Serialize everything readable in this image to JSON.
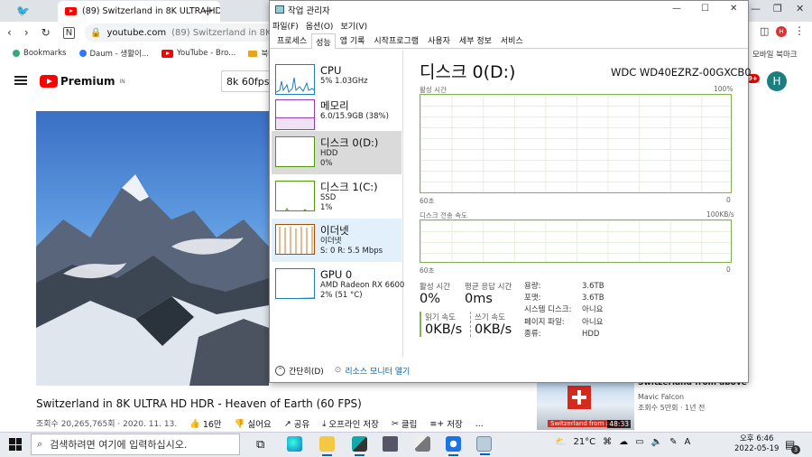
{
  "browser": {
    "tab_title": "(89) Switzerland in 8K ULTRA HD HDR",
    "url_domain": "youtube.com",
    "url_rest": "(89) Switzerland in 8K ULTRA HD",
    "avatar_letter": "H",
    "bookmarks": [
      "Bookmarks",
      "Daum - 생활이...",
      "YouTube - Bro...",
      "북마크"
    ],
    "bookmarks_right": "모바일 북마크"
  },
  "youtube": {
    "logo": "Premium",
    "region": "IN",
    "search_value": "8k 60fps",
    "notif_count": "9+",
    "avatar_letter": "H",
    "title": "Switzerland in 8K ULTRA HD HDR - Heaven of Earth (60 FPS)",
    "meta": "조회수 20,265,765회 · 2020. 11. 13.",
    "actions": {
      "like": "16만",
      "dislike": "싫어요",
      "share": "공유",
      "download": "오프라인 저장",
      "clip": "클립",
      "save": "저장",
      "more": "..."
    },
    "side": {
      "title": "Switzerland from above",
      "channel": "Mavic Falcon",
      "meta": "조회수 5만회 · 1년 전",
      "thumb_caption": "Switzerland from abov",
      "duration": "48:33"
    }
  },
  "taskmanager": {
    "title": "작업 관리자",
    "menu": [
      "파일(F)",
      "옵션(O)",
      "보기(V)"
    ],
    "tabs": [
      "프로세스",
      "성능",
      "앱 기록",
      "시작프로그램",
      "사용자",
      "세부 정보",
      "서비스"
    ],
    "active_tab": "성능",
    "resources": [
      {
        "name": "CPU",
        "l1": "5% 1.03GHz",
        "l2": "",
        "color": "#1f7ec0"
      },
      {
        "name": "메모리",
        "l1": "6.0/15.9GB (38%)",
        "l2": "",
        "color": "#9a3cb4"
      },
      {
        "name": "디스크 0(D:)",
        "l1": "HDD",
        "l2": "0%",
        "color": "#4d9a06"
      },
      {
        "name": "디스크 1(C:)",
        "l1": "SSD",
        "l2": "1%",
        "color": "#4d9a06"
      },
      {
        "name": "이더넷",
        "l1": "이더넷",
        "l2": "S: 0  R: 5.5 Mbps",
        "color": "#a74f01"
      },
      {
        "name": "GPU 0",
        "l1": "AMD Radeon RX 6600",
        "l2": "2% (51 °C)",
        "color": "#1f7ec0"
      }
    ],
    "selected": "디스크 0(D:)",
    "detail": {
      "title": "디스크 0(D:)",
      "model": "WDC WD40EZRZ-00GXCB0",
      "graph1": {
        "label": "활성 시간",
        "max": "100%",
        "time": "60초",
        "min": "0"
      },
      "graph2": {
        "label": "디스크 전송 속도",
        "max": "100KB/s",
        "time": "60초",
        "min": "0"
      },
      "active_time_label": "활성 시간",
      "active_time": "0%",
      "avg_resp_label": "평균 응답 시간",
      "avg_resp": "0ms",
      "read_label": "읽기 속도",
      "read": "0KB/s",
      "write_label": "쓰기 속도",
      "write": "0KB/s",
      "specs": [
        [
          "용량:",
          "3.6TB"
        ],
        [
          "포맷:",
          "3.6TB"
        ],
        [
          "시스템 디스크:",
          "아니요"
        ],
        [
          "페이지 파일:",
          "아니요"
        ],
        [
          "종류:",
          "HDD"
        ]
      ]
    },
    "footer_brief": "간단히(D)",
    "footer_monitor": "리소스 모니터 열기"
  },
  "taskbar": {
    "search_placeholder": "검색하려면 여기에 입력하십시오.",
    "weather": "21°C",
    "lang": "A",
    "time": "오후 6:46",
    "date": "2022-05-19",
    "notif_count": "3"
  }
}
